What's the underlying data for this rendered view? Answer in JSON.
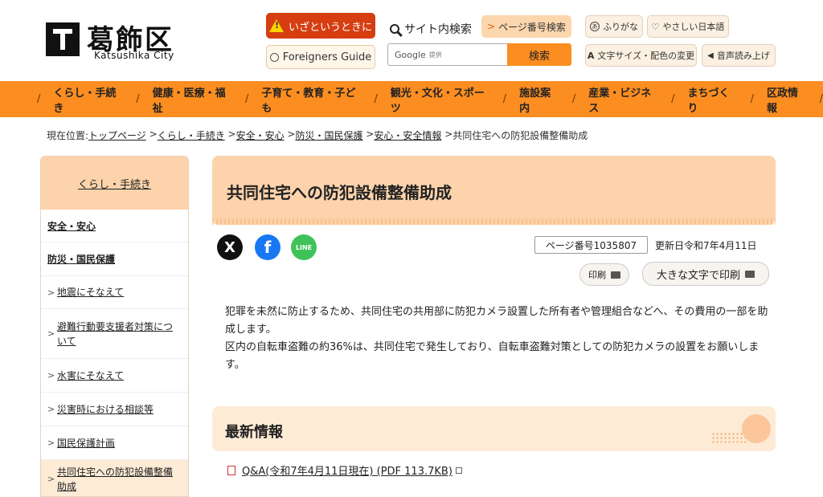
{
  "header": {
    "logo_name": "葛飾区",
    "logo_sub": "Katsushika City",
    "emergency_label": "いざというときに",
    "foreigners_label": "Foreigners Guide",
    "site_search_label": "サイト内検索",
    "page_number_search_label": "ページ番号検索",
    "search_placeholder": "Google",
    "search_provided": "提供",
    "search_button": "検索",
    "furigana_label": "ふりがな",
    "easy_japanese_label": "やさしい日本語",
    "font_color_label": "文字サイズ・配色の変更",
    "voice_label": "音声読み上げ"
  },
  "nav": {
    "items": [
      "くらし・手続き",
      "健康・医療・福祉",
      "子育て・教育・子ども",
      "観光・文化・スポーツ",
      "施設案内",
      "産業・ビジネス",
      "まちづくり",
      "区政情報"
    ]
  },
  "breadcrumb": {
    "prefix": "現在位置:",
    "items": [
      "トップページ",
      "くらし・手続き",
      "安全・安心",
      "防災・国民保護",
      "安心・安全情報"
    ],
    "current": "共同住宅への防犯設備整備助成"
  },
  "sidebar": {
    "heading": "くらし・手続き",
    "items": [
      {
        "label": "安全・安心"
      },
      {
        "label": "防災・国民保護"
      },
      {
        "label": "地震にそなえて"
      },
      {
        "label": "避難行動要支援者対策について"
      },
      {
        "label": "水害にそなえて"
      },
      {
        "label": "災害時における相談等"
      },
      {
        "label": "国民保護計画"
      },
      {
        "label": "共同住宅への防犯設備整備助成"
      }
    ]
  },
  "main": {
    "title": "共同住宅への防犯設備整備助成",
    "page_number": "ページ番号1035807",
    "updated": "更新日令和7年4月11日",
    "print_label": "印刷",
    "large_print_label": "大きな文字で印刷",
    "paragraph1": "犯罪を未然に防止するため、共同住宅の共用部に防犯カメラ設置した所有者や管理組合などへ、その費用の一部を助成します。",
    "paragraph2": "区内の自転車盗難の約36%は、共同住宅で発生しており、自転車盗難対策としての防犯カメラの設置をお願いします。",
    "news_heading": "最新情報",
    "news_link": "Q&A(令和7年4月11日現在) (PDF 113.7KB)"
  },
  "social": {
    "x": "X",
    "facebook": "f",
    "line": "LINE"
  },
  "colors": {
    "nav_orange": "#fb8d21",
    "peach": "#fcd3ab",
    "emergency_red": "#d63e12"
  }
}
